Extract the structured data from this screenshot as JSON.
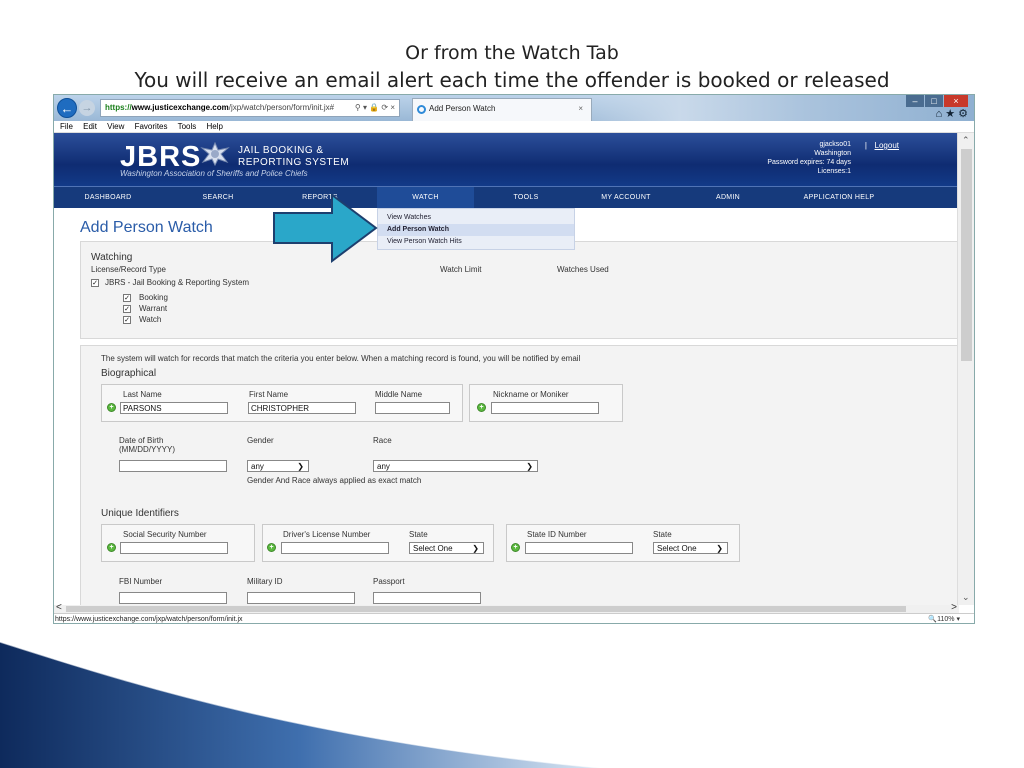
{
  "slide": {
    "title": "Or from the Watch Tab",
    "subtitle": "You will receive an email alert each time the offender is booked or released"
  },
  "browser": {
    "url_scheme": "https://",
    "url_host": "www.justicexchange.com",
    "url_path": "/jxp/watch/person/form/init.jx#",
    "tab_title": "Add Person Watch",
    "menu": [
      "File",
      "Edit",
      "View",
      "Favorites",
      "Tools",
      "Help"
    ],
    "status_url": "https://www.justicexchange.com/jxp/watch/person/form/init.jx",
    "zoom": "110%"
  },
  "header": {
    "logo": "JBRS",
    "system_line1": "JAIL BOOKING &",
    "system_line2": "REPORTING SYSTEM",
    "association": "Washington Association of Sheriffs and Police Chiefs",
    "username": "gjackso01",
    "separator": "|",
    "logout": "Logout",
    "location": "Washington",
    "password_expires": "Password expires: 74 days",
    "licenses": "Licenses:1"
  },
  "nav": {
    "items": [
      "DASHBOARD",
      "SEARCH",
      "REPORTS",
      "WATCH",
      "TOOLS",
      "MY ACCOUNT",
      "ADMIN",
      "APPLICATION HELP"
    ],
    "watch_menu": [
      "View Watches",
      "Add Person Watch",
      "View Person Watch Hits"
    ]
  },
  "page": {
    "title": "Add Person Watch",
    "watching": {
      "heading": "Watching",
      "license_type_label": "License/Record Type",
      "watch_limit_label": "Watch Limit",
      "watches_used_label": "Watches Used",
      "system": "JBRS - Jail Booking & Reporting System",
      "options": [
        "Booking",
        "Warrant",
        "Watch"
      ]
    },
    "intro": "The system will watch for records that match the criteria you enter below. When a matching record is found, you will be notified by email",
    "biographical": {
      "heading": "Biographical",
      "last_name_label": "Last Name",
      "last_name": "PARSONS",
      "first_name_label": "First Name",
      "first_name": "CHRISTOPHER",
      "middle_name_label": "Middle Name",
      "middle_name": "",
      "nickname_label": "Nickname or Moniker",
      "nickname": "",
      "dob_label": "Date of Birth",
      "dob_format": "(MM/DD/YYYY)",
      "dob": "",
      "gender_label": "Gender",
      "gender": "any",
      "race_label": "Race",
      "race": "any",
      "note": "Gender And Race always applied as exact match"
    },
    "unique": {
      "heading": "Unique Identifiers",
      "ssn_label": "Social Security Number",
      "dl_label": "Driver's License Number",
      "dl_state_label": "State",
      "dl_state": "Select One",
      "sid_label": "State ID Number",
      "sid_state_label": "State",
      "sid_state": "Select One",
      "fbi_label": "FBI Number",
      "military_label": "Military ID",
      "passport_label": "Passport"
    }
  },
  "colors": {
    "header_blue": "#0f2c72",
    "title_blue": "#2a5ca8",
    "arrow_fill": "#2aa7c9"
  }
}
